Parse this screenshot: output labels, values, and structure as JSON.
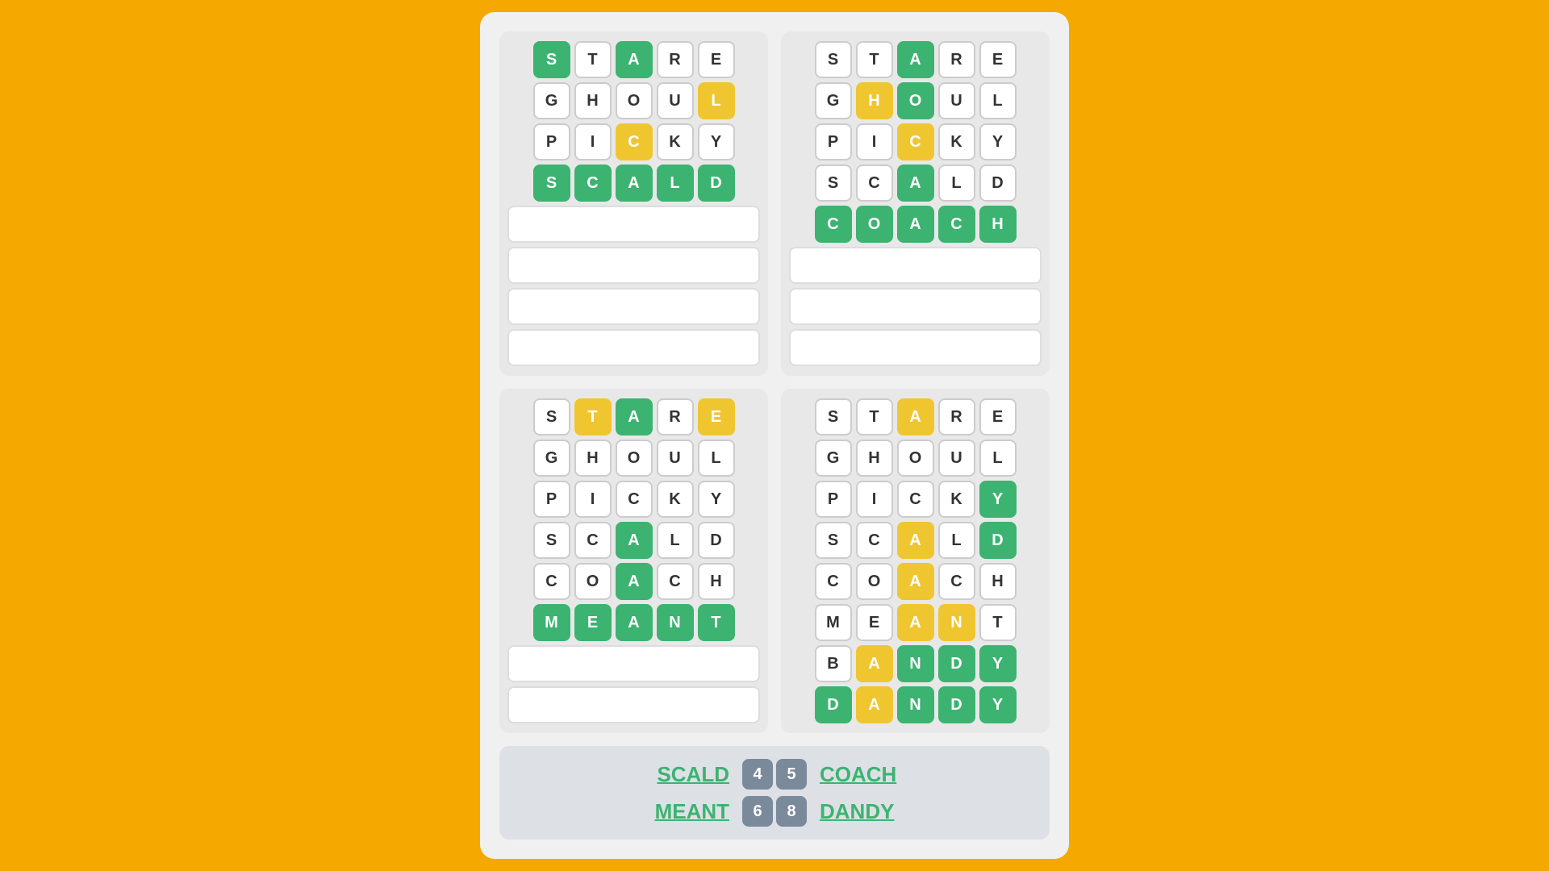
{
  "background_color": "#F5A800",
  "grids": [
    {
      "id": "grid-top-left",
      "rows": [
        [
          {
            "letter": "S",
            "state": "green"
          },
          {
            "letter": "T",
            "state": "white-letter"
          },
          {
            "letter": "A",
            "state": "green"
          },
          {
            "letter": "R",
            "state": "white-letter"
          },
          {
            "letter": "E",
            "state": "white-letter"
          }
        ],
        [
          {
            "letter": "G",
            "state": "white-letter"
          },
          {
            "letter": "H",
            "state": "white-letter"
          },
          {
            "letter": "O",
            "state": "white-letter"
          },
          {
            "letter": "U",
            "state": "white-letter"
          },
          {
            "letter": "L",
            "state": "yellow"
          }
        ],
        [
          {
            "letter": "P",
            "state": "white-letter"
          },
          {
            "letter": "I",
            "state": "white-letter"
          },
          {
            "letter": "C",
            "state": "yellow"
          },
          {
            "letter": "K",
            "state": "white-letter"
          },
          {
            "letter": "Y",
            "state": "white-letter"
          }
        ],
        [
          {
            "letter": "S",
            "state": "green"
          },
          {
            "letter": "C",
            "state": "green"
          },
          {
            "letter": "A",
            "state": "green"
          },
          {
            "letter": "L",
            "state": "green"
          },
          {
            "letter": "D",
            "state": "green"
          }
        ],
        null,
        null,
        null,
        null
      ]
    },
    {
      "id": "grid-top-right",
      "rows": [
        [
          {
            "letter": "S",
            "state": "white-letter"
          },
          {
            "letter": "T",
            "state": "white-letter"
          },
          {
            "letter": "A",
            "state": "green"
          },
          {
            "letter": "R",
            "state": "white-letter"
          },
          {
            "letter": "E",
            "state": "white-letter"
          }
        ],
        [
          {
            "letter": "G",
            "state": "white-letter"
          },
          {
            "letter": "H",
            "state": "yellow"
          },
          {
            "letter": "O",
            "state": "green"
          },
          {
            "letter": "U",
            "state": "white-letter"
          },
          {
            "letter": "L",
            "state": "white-letter"
          }
        ],
        [
          {
            "letter": "P",
            "state": "white-letter"
          },
          {
            "letter": "I",
            "state": "white-letter"
          },
          {
            "letter": "C",
            "state": "yellow"
          },
          {
            "letter": "K",
            "state": "white-letter"
          },
          {
            "letter": "Y",
            "state": "white-letter"
          }
        ],
        [
          {
            "letter": "S",
            "state": "white-letter"
          },
          {
            "letter": "C",
            "state": "white-letter"
          },
          {
            "letter": "A",
            "state": "green"
          },
          {
            "letter": "L",
            "state": "white-letter"
          },
          {
            "letter": "D",
            "state": "white-letter"
          }
        ],
        [
          {
            "letter": "C",
            "state": "green"
          },
          {
            "letter": "O",
            "state": "green"
          },
          {
            "letter": "A",
            "state": "green"
          },
          {
            "letter": "C",
            "state": "green"
          },
          {
            "letter": "H",
            "state": "green"
          }
        ],
        null,
        null,
        null
      ]
    },
    {
      "id": "grid-bottom-left",
      "rows": [
        [
          {
            "letter": "S",
            "state": "white-letter"
          },
          {
            "letter": "T",
            "state": "yellow"
          },
          {
            "letter": "A",
            "state": "green"
          },
          {
            "letter": "R",
            "state": "white-letter"
          },
          {
            "letter": "E",
            "state": "yellow"
          }
        ],
        [
          {
            "letter": "G",
            "state": "white-letter"
          },
          {
            "letter": "H",
            "state": "white-letter"
          },
          {
            "letter": "O",
            "state": "white-letter"
          },
          {
            "letter": "U",
            "state": "white-letter"
          },
          {
            "letter": "L",
            "state": "white-letter"
          }
        ],
        [
          {
            "letter": "P",
            "state": "white-letter"
          },
          {
            "letter": "I",
            "state": "white-letter"
          },
          {
            "letter": "C",
            "state": "white-letter"
          },
          {
            "letter": "K",
            "state": "white-letter"
          },
          {
            "letter": "Y",
            "state": "white-letter"
          }
        ],
        [
          {
            "letter": "S",
            "state": "white-letter"
          },
          {
            "letter": "C",
            "state": "white-letter"
          },
          {
            "letter": "A",
            "state": "green"
          },
          {
            "letter": "L",
            "state": "white-letter"
          },
          {
            "letter": "D",
            "state": "white-letter"
          }
        ],
        [
          {
            "letter": "C",
            "state": "white-letter"
          },
          {
            "letter": "O",
            "state": "white-letter"
          },
          {
            "letter": "A",
            "state": "green"
          },
          {
            "letter": "C",
            "state": "white-letter"
          },
          {
            "letter": "H",
            "state": "white-letter"
          }
        ],
        [
          {
            "letter": "M",
            "state": "green"
          },
          {
            "letter": "E",
            "state": "green"
          },
          {
            "letter": "A",
            "state": "green"
          },
          {
            "letter": "N",
            "state": "green"
          },
          {
            "letter": "T",
            "state": "green"
          }
        ],
        null,
        null
      ]
    },
    {
      "id": "grid-bottom-right",
      "rows": [
        [
          {
            "letter": "S",
            "state": "white-letter"
          },
          {
            "letter": "T",
            "state": "white-letter"
          },
          {
            "letter": "A",
            "state": "yellow"
          },
          {
            "letter": "R",
            "state": "white-letter"
          },
          {
            "letter": "E",
            "state": "white-letter"
          }
        ],
        [
          {
            "letter": "G",
            "state": "white-letter"
          },
          {
            "letter": "H",
            "state": "white-letter"
          },
          {
            "letter": "O",
            "state": "white-letter"
          },
          {
            "letter": "U",
            "state": "white-letter"
          },
          {
            "letter": "L",
            "state": "white-letter"
          }
        ],
        [
          {
            "letter": "P",
            "state": "white-letter"
          },
          {
            "letter": "I",
            "state": "white-letter"
          },
          {
            "letter": "C",
            "state": "white-letter"
          },
          {
            "letter": "K",
            "state": "white-letter"
          },
          {
            "letter": "Y",
            "state": "green"
          }
        ],
        [
          {
            "letter": "S",
            "state": "white-letter"
          },
          {
            "letter": "C",
            "state": "white-letter"
          },
          {
            "letter": "A",
            "state": "yellow"
          },
          {
            "letter": "L",
            "state": "white-letter"
          },
          {
            "letter": "D",
            "state": "green"
          }
        ],
        [
          {
            "letter": "C",
            "state": "white-letter"
          },
          {
            "letter": "O",
            "state": "white-letter"
          },
          {
            "letter": "A",
            "state": "yellow"
          },
          {
            "letter": "C",
            "state": "white-letter"
          },
          {
            "letter": "H",
            "state": "white-letter"
          }
        ],
        [
          {
            "letter": "M",
            "state": "white-letter"
          },
          {
            "letter": "E",
            "state": "white-letter"
          },
          {
            "letter": "A",
            "state": "yellow"
          },
          {
            "letter": "N",
            "state": "yellow"
          },
          {
            "letter": "T",
            "state": "white-letter"
          }
        ],
        [
          {
            "letter": "B",
            "state": "white-letter"
          },
          {
            "letter": "A",
            "state": "yellow"
          },
          {
            "letter": "N",
            "state": "green"
          },
          {
            "letter": "D",
            "state": "green"
          },
          {
            "letter": "Y",
            "state": "green"
          }
        ],
        [
          {
            "letter": "D",
            "state": "green"
          },
          {
            "letter": "A",
            "state": "yellow"
          },
          {
            "letter": "N",
            "state": "green"
          },
          {
            "letter": "D",
            "state": "green"
          },
          {
            "letter": "Y",
            "state": "green"
          }
        ]
      ]
    }
  ],
  "bottom_bar": {
    "row1": {
      "left_word": "SCALD",
      "badges": [
        "4",
        "5"
      ],
      "right_word": "COACH"
    },
    "row2": {
      "left_word": "MEANT",
      "badges": [
        "6",
        "8"
      ],
      "right_word": "DANDY"
    }
  }
}
